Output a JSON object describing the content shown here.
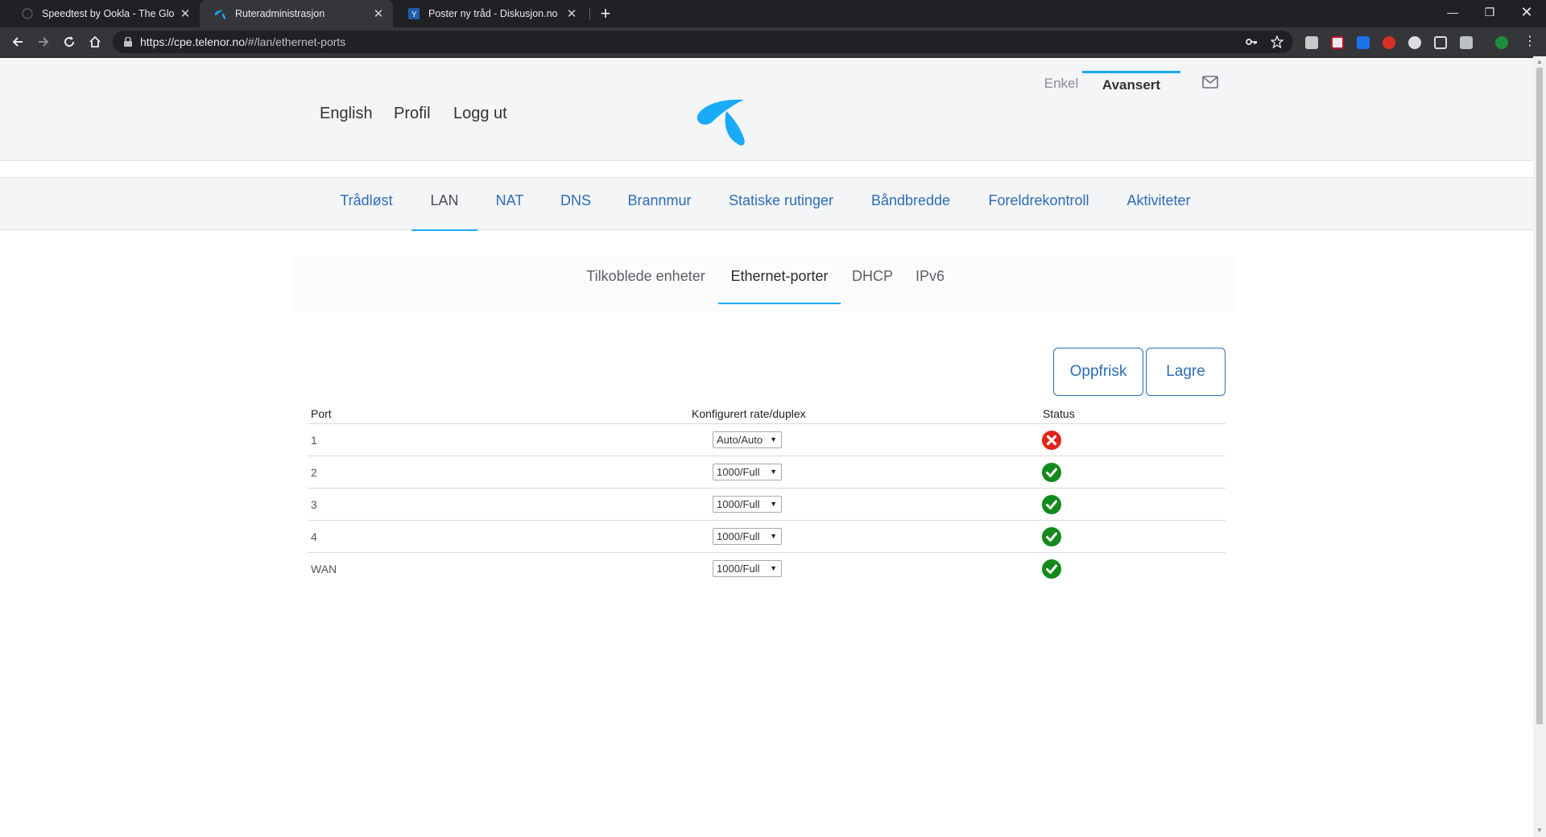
{
  "browser": {
    "tabs": [
      {
        "title": "Speedtest by Ookla - The Global",
        "icon": "speedtest-icon"
      },
      {
        "title": "Ruteradministrasjon",
        "icon": "telenor-icon"
      },
      {
        "title": "Poster ny tråd - Diskusjon.no",
        "icon": "diskusjon-icon"
      }
    ],
    "url_host": "https://cpe.telenor.no",
    "url_path": "/#/lan/ethernet-ports"
  },
  "header": {
    "mode_tabs": [
      "Enkel",
      "Avansert"
    ],
    "links": [
      "English",
      "Profil",
      "Logg ut"
    ]
  },
  "main_nav": [
    "Trådløst",
    "LAN",
    "NAT",
    "DNS",
    "Brannmur",
    "Statiske rutinger",
    "Båndbredde",
    "Foreldrekontroll",
    "Aktiviteter"
  ],
  "sub_nav": [
    "Tilkoblede enheter",
    "Ethernet-porter",
    "DHCP",
    "IPv6"
  ],
  "buttons": {
    "refresh": "Oppfrisk",
    "save": "Lagre"
  },
  "table": {
    "headers": [
      "Port",
      "Konfigurert rate/duplex",
      "Status"
    ],
    "rows": [
      {
        "port": "1",
        "rate": "Auto/Auto",
        "status": "error"
      },
      {
        "port": "2",
        "rate": "1000/Full",
        "status": "ok"
      },
      {
        "port": "3",
        "rate": "1000/Full",
        "status": "ok"
      },
      {
        "port": "4",
        "rate": "1000/Full",
        "status": "ok"
      },
      {
        "port": "WAN",
        "rate": "1000/Full",
        "status": "ok"
      }
    ]
  },
  "colors": {
    "accent": "#19aaf8",
    "link": "#2d6db6",
    "ok": "#138a1c",
    "error": "#e2231a"
  }
}
